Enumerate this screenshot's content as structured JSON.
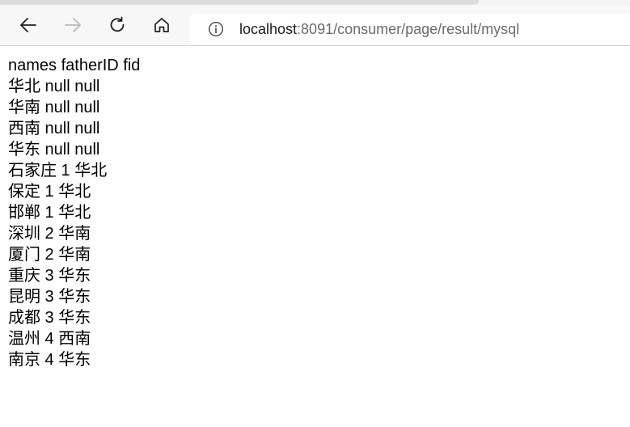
{
  "browser": {
    "icons": {
      "back": "back-arrow-icon",
      "forward": "forward-arrow-icon",
      "reload": "reload-icon",
      "home": "home-icon",
      "info": "info-icon"
    },
    "address": {
      "host": "localhost",
      "path": ":8091/consumer/page/result/mysql"
    }
  },
  "content": {
    "header": "names fatherID fid",
    "rows": [
      "华北 null null",
      "华南 null null",
      "西南 null null",
      "华东 null null",
      "石家庄 1 华北",
      "保定 1 华北",
      "邯郸 1 华北",
      "深圳 2 华南",
      "厦门 2 华南",
      "重庆 3 华东",
      "昆明 3 华东",
      "成都 3 华东",
      "温州 4 西南",
      "南京 4 华东"
    ]
  }
}
